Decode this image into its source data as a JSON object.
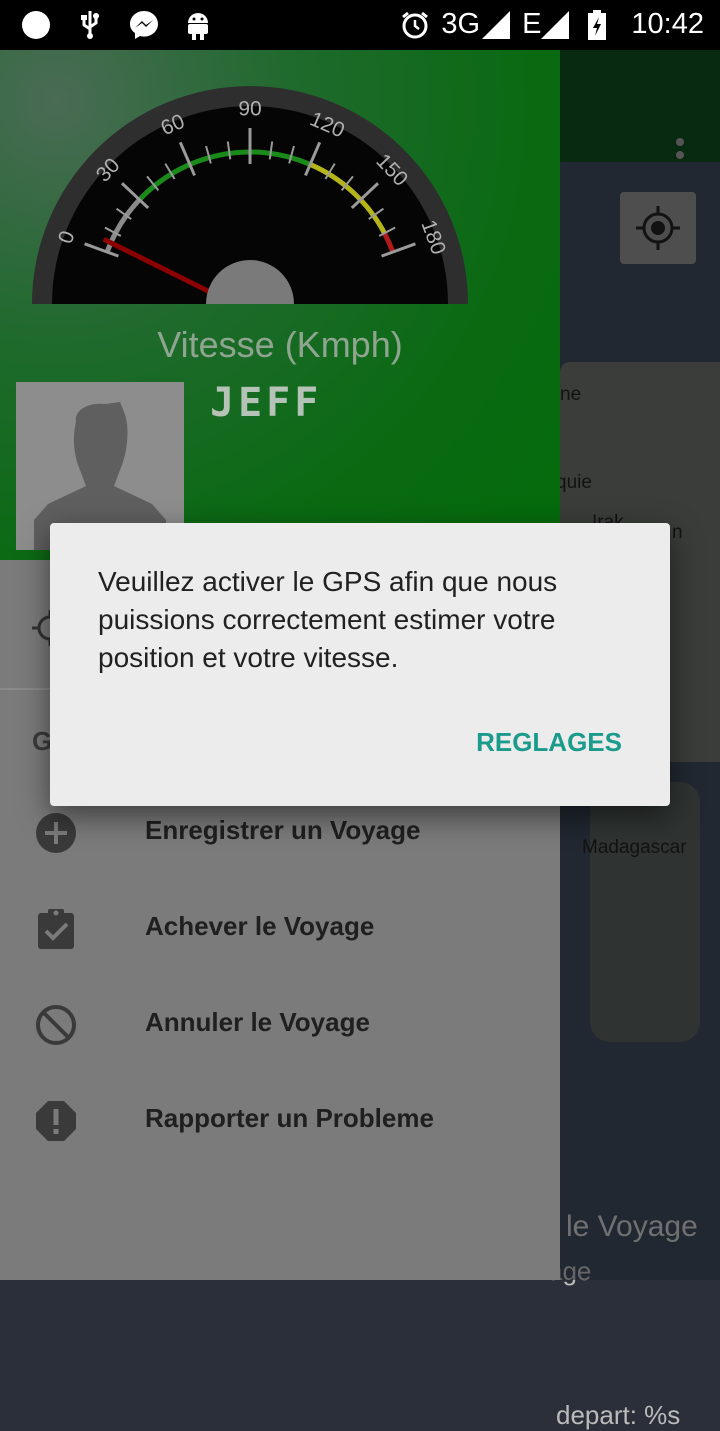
{
  "status_bar": {
    "network": "3G",
    "signal2": "E",
    "time": "10:42",
    "icons": [
      "dot-icon",
      "usb-icon",
      "messenger-icon",
      "android-icon",
      "alarm-icon",
      "signal-icon",
      "signal-icon",
      "battery-charging-icon"
    ]
  },
  "drawer": {
    "gauge": {
      "ticks": [
        "0",
        "30",
        "60",
        "90",
        "120",
        "150",
        "180"
      ],
      "value": 5,
      "max": 180
    },
    "speed_label": "Vitesse (Kmph)",
    "user_name": "JEFF",
    "section_initial": "G",
    "menu": [
      {
        "label": "Enregistrer un Voyage",
        "icon": "add-circle-icon"
      },
      {
        "label": "Achever le Voyage",
        "icon": "clipboard-check-icon"
      },
      {
        "label": "Annuler le Voyage",
        "icon": "block-icon"
      },
      {
        "label": "Rapporter un Probleme",
        "icon": "error-octagon-icon"
      }
    ]
  },
  "map": {
    "labels": {
      "fragment_ne": "ne",
      "fragment_quie": "quie",
      "fragment_irak": "Irak",
      "fragment_n": "n",
      "madagascar": "Madagascar"
    },
    "voyage_fragment": "le Voyage",
    "age_fragment": "age",
    "depart_fragment": "depart: %s"
  },
  "dialog": {
    "message": "Veuillez activer le GPS afin que nous puissions correctement estimer votre position et votre vitesse.",
    "button": "REGLAGES"
  },
  "colors": {
    "accent": "#1a9b8b",
    "header_green": "#046b0b",
    "needle": "#8b0000"
  }
}
